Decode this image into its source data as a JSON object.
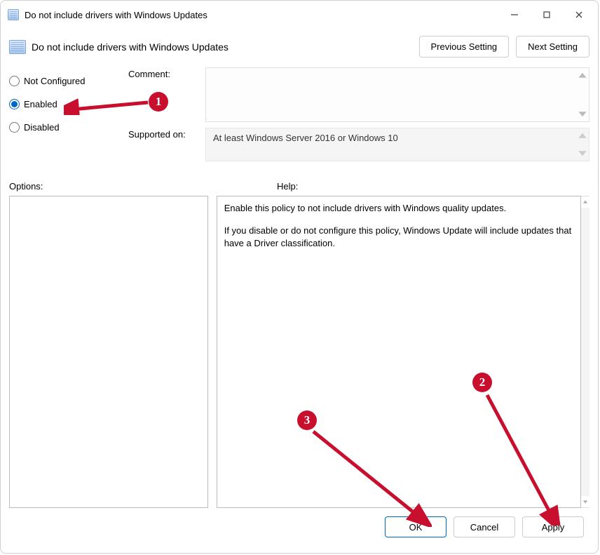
{
  "window": {
    "title": "Do not include drivers with Windows Updates"
  },
  "header": {
    "title": "Do not include drivers with Windows Updates",
    "prev_btn": "Previous Setting",
    "next_btn": "Next Setting"
  },
  "state": {
    "not_configured": "Not Configured",
    "enabled": "Enabled",
    "disabled": "Disabled",
    "selected": "enabled"
  },
  "fields": {
    "comment_label": "Comment:",
    "comment_value": "",
    "supported_label": "Supported on:",
    "supported_value": "At least Windows Server 2016 or Windows 10"
  },
  "labels": {
    "options": "Options:",
    "help": "Help:"
  },
  "help": {
    "p1": "Enable this policy to not include drivers with Windows quality updates.",
    "p2": "If you disable or do not configure this policy, Windows Update will include updates that have a Driver classification."
  },
  "footer": {
    "ok": "OK",
    "cancel": "Cancel",
    "apply": "Apply"
  },
  "annotations": {
    "b1": "1",
    "b2": "2",
    "b3": "3"
  }
}
